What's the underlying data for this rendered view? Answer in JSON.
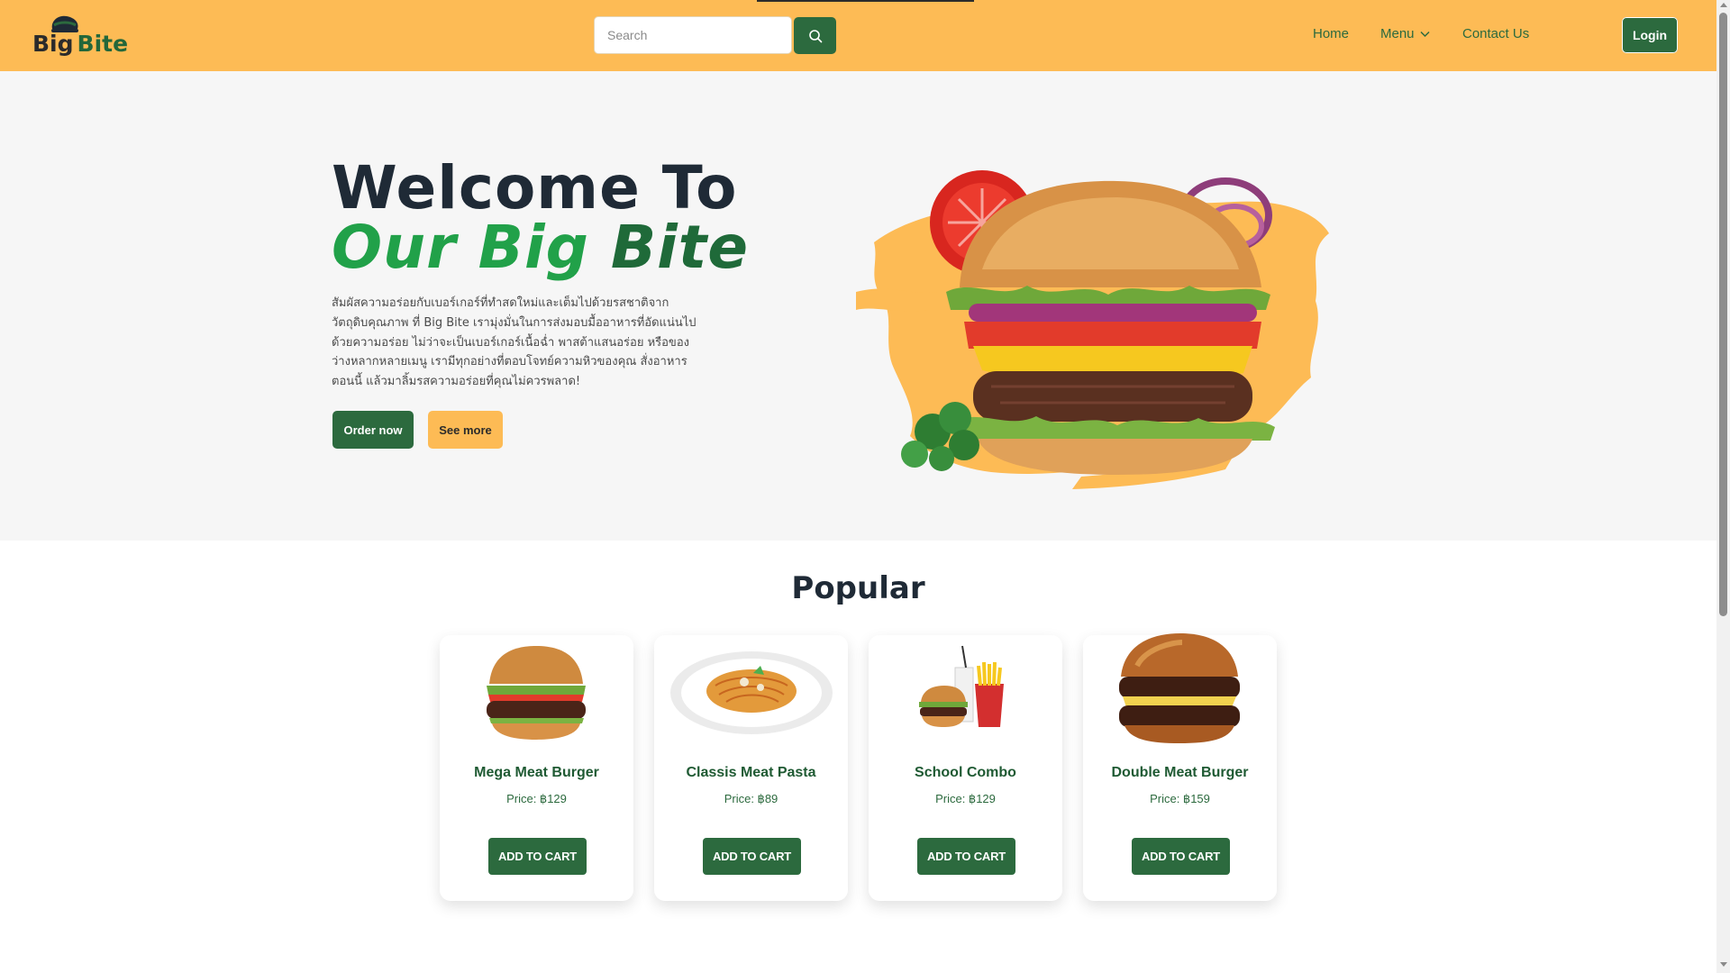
{
  "brand": {
    "word1": "Big",
    "word2": "Bite",
    "logo_icon": "chef-hat-icon"
  },
  "search": {
    "placeholder": "Search",
    "value": "",
    "icon": "search-icon"
  },
  "nav": {
    "home": "Home",
    "menu": "Menu",
    "contact": "Contact Us",
    "login": "Login"
  },
  "hero": {
    "title_line1": "Welcome To",
    "title_word1": "Our",
    "title_word2": "Big",
    "title_word3": "Bite",
    "description": "สัมผัสความอร่อยกับเบอร์เกอร์ที่ทำสดใหม่และเต็มไปด้วยรสชาติจากวัตถุดิบคุณภาพ ที่ Big Bite เรามุ่งมั่นในการส่งมอบมื้ออาหารที่อัดแน่นไปด้วยความอร่อย ไม่ว่าจะเป็นเบอร์เกอร์เนื้อฉ่ำ พาสต้าแสนอร่อย หรือของว่างหลากหลายเมนู เรามีทุกอย่างที่ตอบโจทย์ความหิวของคุณ สั่งอาหารตอนนี้ แล้วมาลิ้มรสความอร่อยที่คุณไม่ควรพลาด!",
    "order_button": "Order now",
    "see_more_button": "See more"
  },
  "popular": {
    "title": "Popular",
    "items": [
      {
        "name": "Mega Meat Burger",
        "price": "Price: ฿129",
        "button": "ADD TO CART"
      },
      {
        "name": "Classis Meat Pasta",
        "price": "Price: ฿89",
        "button": "ADD TO CART"
      },
      {
        "name": "School Combo",
        "price": "Price: ฿129",
        "button": "ADD TO CART"
      },
      {
        "name": "Double Meat Burger",
        "price": "Price: ฿159",
        "button": "ADD TO CART"
      }
    ]
  },
  "colors": {
    "header_bg": "#fdbb55",
    "primary_green": "#2c6a3e",
    "accent_green": "#21a149",
    "hero_bg": "#f6f6f6"
  }
}
